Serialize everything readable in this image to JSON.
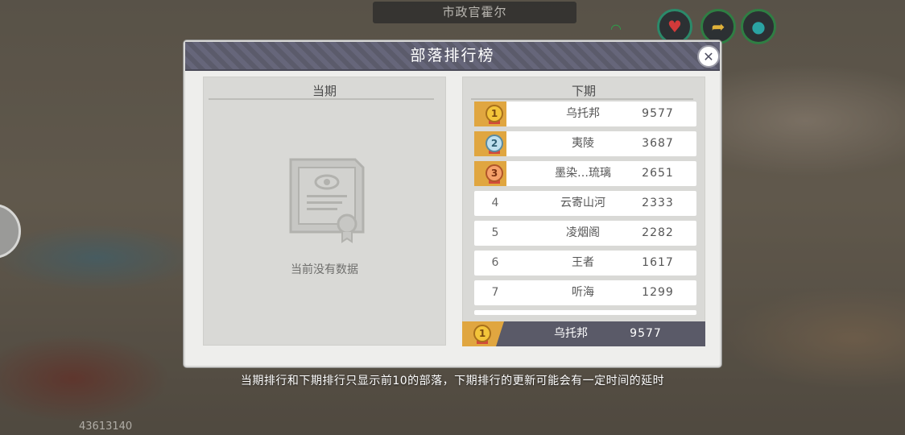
{
  "npc": {
    "name": "市政官霍尔"
  },
  "modal": {
    "title": "部落排行榜",
    "close_icon": "close-icon"
  },
  "current": {
    "title": "当期",
    "empty_text": "当前没有数据"
  },
  "next": {
    "title": "下期",
    "rows": [
      {
        "rank": "1",
        "name": "乌托邦",
        "score": "9577",
        "medal": "gold"
      },
      {
        "rank": "2",
        "name": "夷陵",
        "score": "3687",
        "medal": "silver"
      },
      {
        "rank": "3",
        "name": "墨染…琉璃",
        "score": "2651",
        "medal": "bronze"
      },
      {
        "rank": "4",
        "name": "云寄山河",
        "score": "2333"
      },
      {
        "rank": "5",
        "name": "凌烟阁",
        "score": "2282"
      },
      {
        "rank": "6",
        "name": "王者",
        "score": "1617"
      },
      {
        "rank": "7",
        "name": "听海",
        "score": "1299"
      }
    ],
    "my_tribe": {
      "rank": "1",
      "name": "乌托邦",
      "score": "9577"
    }
  },
  "notice": "当期排行和下期排行只显示前10的部落，下期排行的更新可能会有一定时间的延时",
  "uid": "43613140",
  "colors": {
    "header": "#5b5b6b",
    "gold": "#e0a640",
    "footer": "#5a5a68"
  }
}
